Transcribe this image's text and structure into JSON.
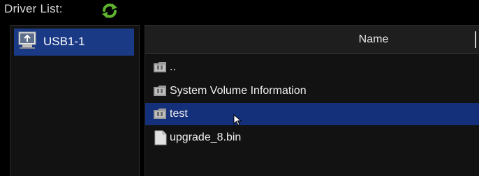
{
  "header": {
    "label": "Driver List:",
    "refresh_icon": "refresh-icon"
  },
  "drives": [
    {
      "label": "USB1-1",
      "icon": "usb-drive-icon",
      "selected": true
    }
  ],
  "file_list": {
    "column_header": "Name",
    "rows": [
      {
        "label": "..",
        "icon": "folder-icon",
        "selected": false
      },
      {
        "label": "System Volume Information",
        "icon": "folder-icon",
        "selected": false
      },
      {
        "label": "test",
        "icon": "folder-icon",
        "selected": true
      },
      {
        "label": "upgrade_8.bin",
        "icon": "file-icon",
        "selected": false
      }
    ]
  },
  "colors": {
    "background": "#000000",
    "pane": "#121212",
    "selection": "#14307a",
    "drive_selection": "#1b3a86",
    "refresh_green": "#5fb32e"
  }
}
